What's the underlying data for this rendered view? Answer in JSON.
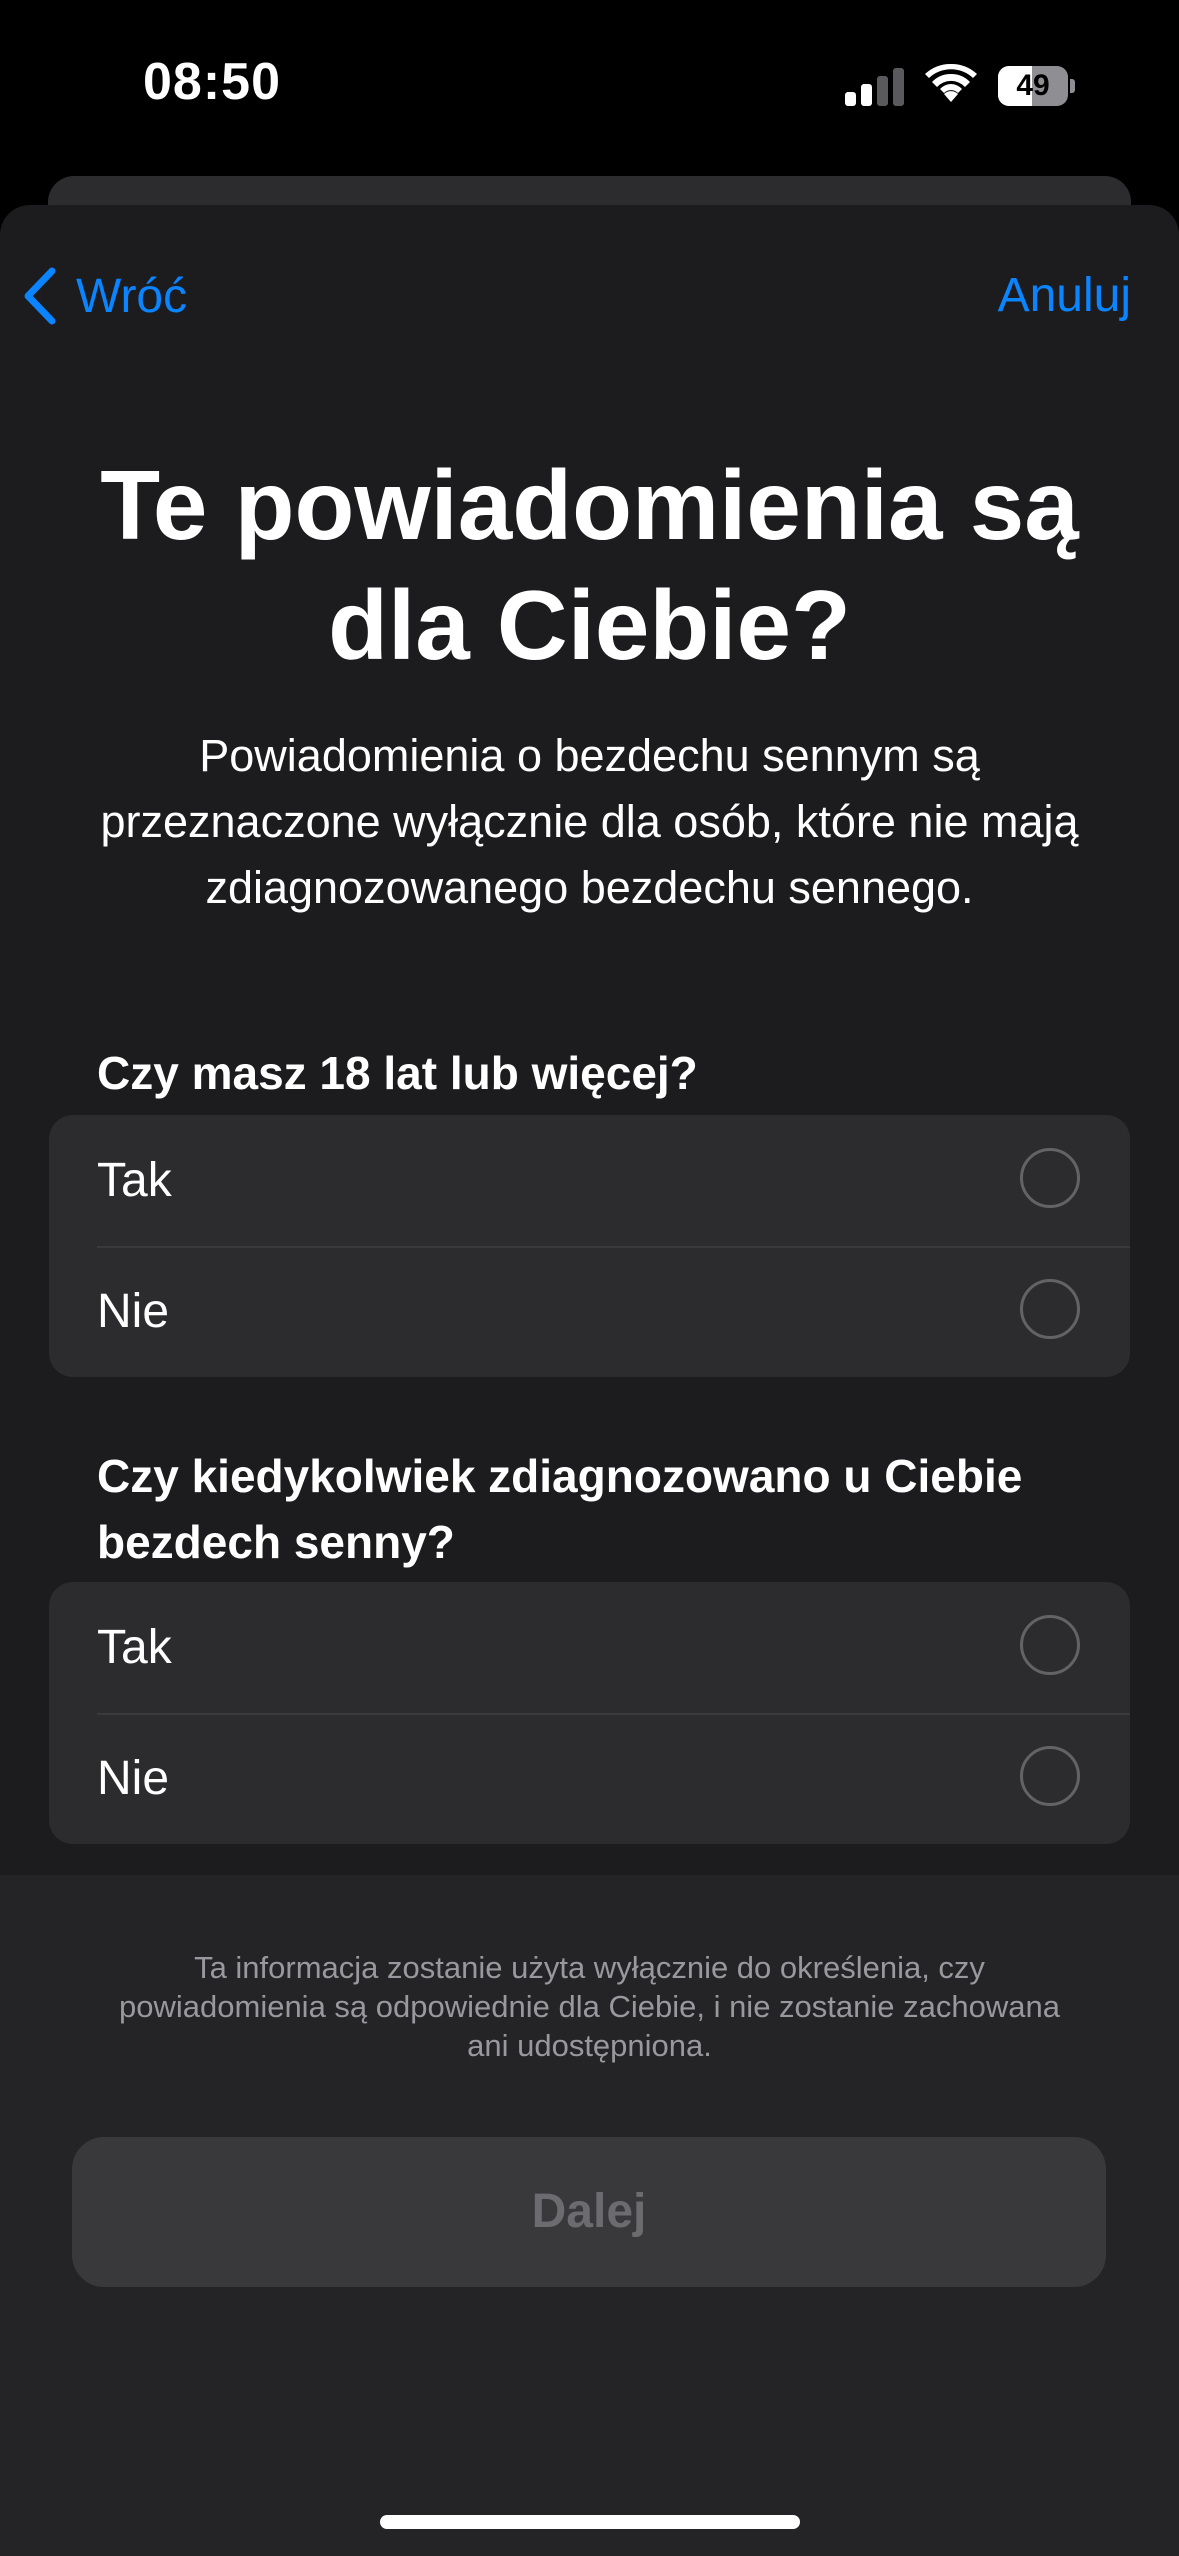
{
  "status_bar": {
    "time": "08:50",
    "battery": "49",
    "battery_level": 0.49,
    "signal_bars_active": 2,
    "signal_bars_total": 4
  },
  "nav": {
    "back_icon": "chevron-left-icon",
    "back_label": "Wróć",
    "cancel_label": "Anuluj"
  },
  "title": "Te powiadomienia są dla Ciebie?",
  "subtitle": "Powiadomienia o bezdechu sennym są przeznaczone wyłącznie dla osób, które nie mają zdiagnozowanego bezdechu sennego.",
  "questions": [
    {
      "text": "Czy masz 18 lat lub więcej?",
      "options": [
        {
          "label": "Tak",
          "selected": false
        },
        {
          "label": "Nie",
          "selected": false
        }
      ]
    },
    {
      "text": "Czy kiedykolwiek zdiagnozowano u Ciebie bezdech senny?",
      "options": [
        {
          "label": "Tak",
          "selected": false
        },
        {
          "label": "Nie",
          "selected": false
        }
      ]
    }
  ],
  "footer": {
    "disclaimer": "Ta informacja zostanie użyta wyłącznie do określenia, czy powiadomienia są odpowiednie dla Ciebie, i nie zostanie zachowana ani udostępniona.",
    "next_label": "Dalej",
    "next_enabled": false
  },
  "colors": {
    "accent": "#0a84ff",
    "background": "#000000",
    "sheet": "#1c1c1e",
    "group": "#2c2c2e",
    "disabled_text": "#6c6c70"
  }
}
